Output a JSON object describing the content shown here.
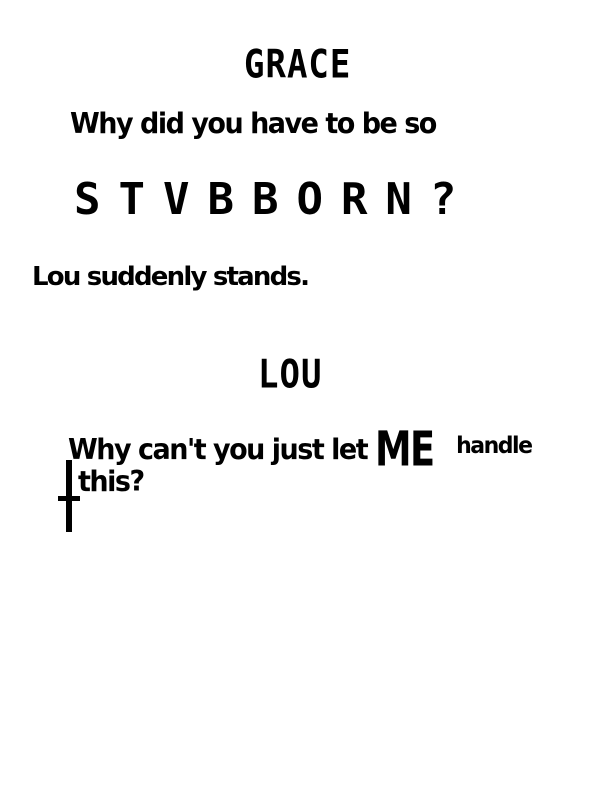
{
  "script": {
    "character_1": "GRACE",
    "line_1": "Why did you have to be so",
    "line_1_shout": "STVBBORN?",
    "action": "Lou suddenly stands.",
    "character_2": "LOU",
    "line_2_a": "Why can't you just let",
    "line_2_emph": "ME",
    "line_2_b": "handle",
    "line_2_c": "this?"
  }
}
